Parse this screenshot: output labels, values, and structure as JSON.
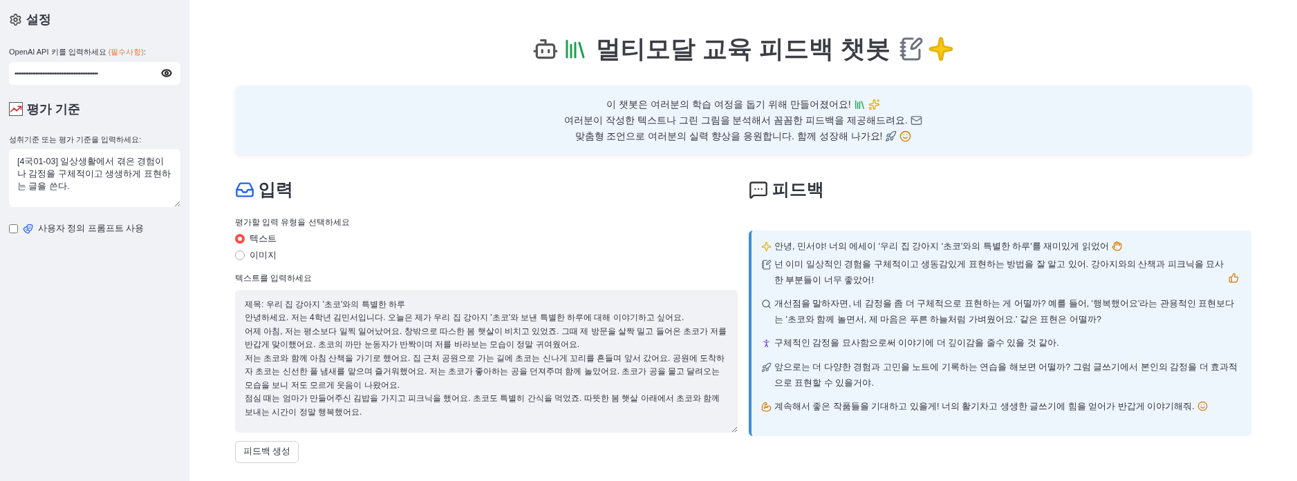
{
  "sidebar": {
    "settings_title": "설정",
    "api_key": {
      "label": "OpenAI API 키를 입력하세요 ",
      "label_required": "(필수사항)",
      "label_end": ":",
      "value": "••••••••••••••••••••••••••••••••••••••••••••••••"
    },
    "criteria_title": "평가 기준",
    "criteria": {
      "label": "성취기준 또는 평가 기준을 입력하세요:",
      "value": "[4국01-03] 일상생활에서 겪은 경험이나 감정을 구체적이고 생생하게 표현하는 글을 쓴다."
    },
    "custom_prompt": {
      "label": "사용자 정의 프롬프트 사용",
      "checked": false
    }
  },
  "title": "멀티모달 교육 피드백 챗봇",
  "intro": [
    "이 챗봇은 여러분의 학습 여정을 돕기 위해 만들어졌어요!",
    "여러분이 작성한 텍스트나 그린 그림을 분석해서 꼼꼼한 피드백을 제공해드려요.",
    "맞춤형 조언으로 여러분의 실력 향상을 응원합니다. 함께 성장해 나가요!"
  ],
  "input": {
    "title": "입력",
    "type_label": "평가할 입력 유형을 선택하세요",
    "types": [
      {
        "label": "텍스트",
        "selected": true
      },
      {
        "label": "이미지",
        "selected": false
      }
    ],
    "text_label": "텍스트를 입력하세요",
    "text_value": "제목: 우리 집 강아지 '초코'와의 특별한 하루\n안녕하세요. 저는 4학년 김민서입니다. 오늘은 제가 우리 집 강아지 '초코'와 보낸 특별한 하루에 대해 이야기하고 싶어요.\n어제 아침, 저는 평소보다 일찍 일어났어요. 창밖으로 따스한 봄 햇살이 비치고 있었죠. 그때 제 방문을 살짝 밀고 들어온 초코가 저를 반갑게 맞이했어요. 초코의 까만 눈동자가 반짝이며 저를 바라보는 모습이 정말 귀여웠어요.\n저는 초코와 함께 아침 산책을 가기로 했어요. 집 근처 공원으로 가는 길에 초코는 신나게 꼬리를 흔들며 앞서 갔어요. 공원에 도착하자 초코는 신선한 풀 냄새를 맡으며 즐거워했어요. 저는 초코가 좋아하는 공을 던져주며 함께 놀았어요. 초코가 공을 물고 달려오는 모습을 보니 저도 모르게 웃음이 나왔어요.\n점심 때는 엄마가 만들어주신 김밥을 가지고 피크닉을 했어요. 초코도 특별히 간식을 먹었죠. 따뜻한 봄 햇살 아래에서 초코와 함께 보내는 시간이 정말 행복했어요.",
    "button": "피드백 생성"
  },
  "feedback": {
    "title": "피드백",
    "paragraphs": [
      [
        "안녕, 민서야! 너의 에세이 '우리 집 강아지 '초코'와의 특별한 하루'를 재미있게 읽었어",
        "넌 이미 일상적인 경험을 구체적이고 생동감있게 표현하는 방법을 잘 알고 있어. 강아지와의 산책과 피크닉을 묘사한 부분들이 너무 좋았어!"
      ],
      [
        "개선점을 말하자면, 네 감정을 좀 더 구체적으로 표현하는 게 어떨까? 예를 들어, '행복했어요'라는 관용적인 표현보다는 '초코와 함께 놀면서, 제 마음은 푸른 하늘처럼 가벼웠어요.' 같은 표현은 어떨까?"
      ],
      [
        "구체적인 감정을 묘사함으로써 이야기에 더 깊이감을 줄수 있을 것 같아."
      ],
      [
        "앞으로는 더 다양한 경험과 고민을 노트에 기록하는 연습을 해보면 어떨까? 그럼 글쓰기에서 본인의 감정을 더 효과적으로 표현할 수 있을거야."
      ],
      [
        "계속해서 좋은 작품들을 기대하고 있을게! 너의 활기차고 생생한 글쓰기에 힘을 얻어가 반갑게 이야기해줘."
      ]
    ]
  }
}
